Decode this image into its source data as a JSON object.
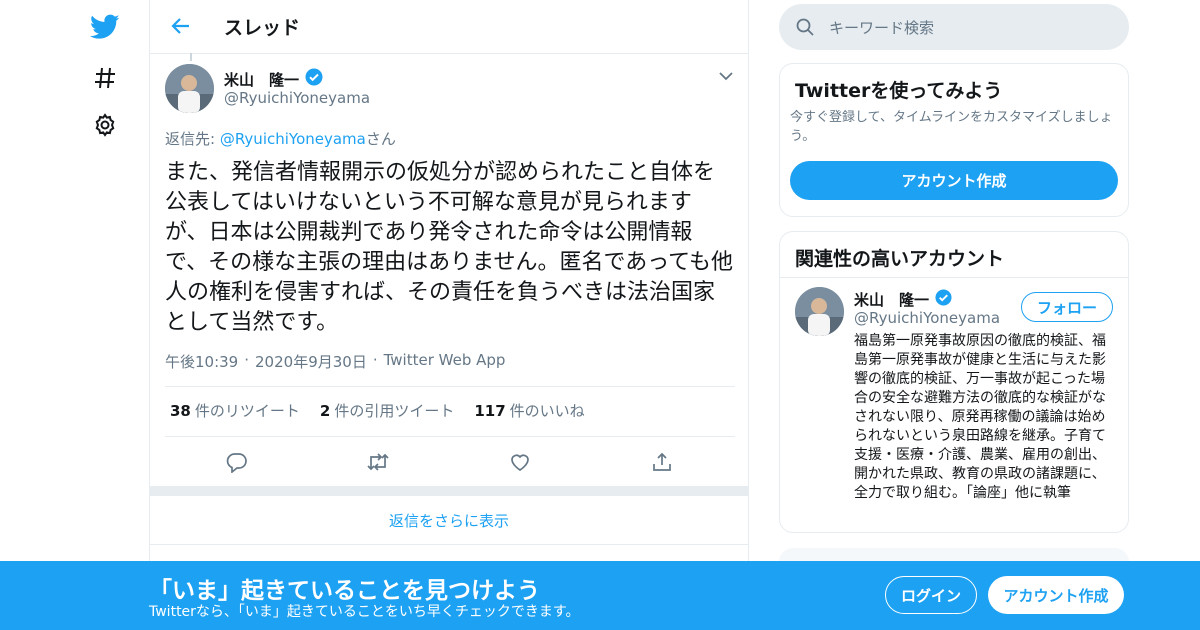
{
  "colors": {
    "accent": "#1da1f2",
    "text": "#14171a",
    "secondary": "#657786",
    "border": "#e6ecf0"
  },
  "nav": {
    "icons": [
      "twitter-bird-icon",
      "hashtag-icon",
      "gear-icon"
    ]
  },
  "header": {
    "title": "スレッド"
  },
  "tweet": {
    "author_name": "米山　隆一",
    "author_handle": "@RyuichiYoneyama",
    "reply_prefix": "返信先: ",
    "reply_handle": "@RyuichiYoneyama",
    "reply_suffix": "さん",
    "text": "また、発信者情報開示の仮処分が認められたこと自体を公表してはいけないという不可解な意見が見られますが、日本は公開裁判であり発令された命令は公開情報で、その様な主張の理由はありません。匿名であっても他人の権利を侵害すれば、その責任を負うべきは法治国家として当然です。",
    "time": "午後10:39",
    "date": "2020年9月30日",
    "source": "Twitter Web App",
    "sep": "·",
    "retweets": "38",
    "retweets_label": "件のリツイート",
    "quotes": "2",
    "quotes_label": "件の引用ツイート",
    "likes": "117",
    "likes_label": "件のいいね"
  },
  "show_more": "返信をさらに表示",
  "search": {
    "placeholder": "キーワード検索"
  },
  "signup_card": {
    "title": "Twitterを使ってみよう",
    "desc": "今すぐ登録して、タイムラインをカスタマイズしましょう。",
    "button": "アカウント作成"
  },
  "related_card": {
    "title": "関連性の高いアカウント",
    "name": "米山　隆一",
    "handle": "@RyuichiYoneyama",
    "follow": "フォロー",
    "bio": "福島第一原発事故原因の徹底的検証、福島第一原発事故が健康と生活に与えた影響の徹底的検証、万一事故が起こった場合の安全な避難方法の徹底的な検証がなされない限り、原発再稼働の議論は始められないという泉田路線を継承。子育て支援・医療・介護、農業、雇用の創出、開かれた県政、教育の県政の諸課題に、全力で取り組む。「論座」他に執筆"
  },
  "bottom_bar": {
    "title": "「いま」起きていることを見つけよう",
    "sub": "Twitterなら、「いま」起きていることをいち早くチェックできます。",
    "login": "ログイン",
    "signup": "アカウント作成"
  }
}
